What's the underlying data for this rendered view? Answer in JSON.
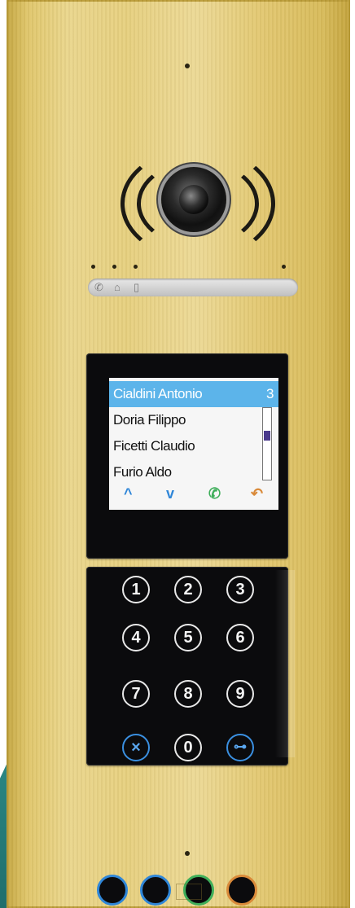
{
  "lcd": {
    "entries": [
      {
        "name": "Cialdini Antonio",
        "count": "3"
      },
      {
        "name": "Doria Filippo"
      },
      {
        "name": "Ficetti Claudio"
      },
      {
        "name": "Furio Aldo"
      }
    ],
    "nav": {
      "up": "^",
      "down": "v",
      "call": "✆",
      "back": "↶"
    },
    "accent": "#5cb4ea"
  },
  "indicators": {
    "icons": [
      "handset-icon",
      "door-icon",
      "speaker-icon"
    ]
  },
  "keypad": {
    "keys": [
      "1",
      "2",
      "3",
      "4",
      "5",
      "6",
      "7",
      "8",
      "9",
      "×",
      "0",
      "⊶"
    ],
    "key_icons": {
      "cancel": "cancel-icon",
      "key": "key-icon"
    }
  },
  "colors": {
    "panel": "#e6cf7e",
    "ring_blue": "#2f86d8",
    "ring_green": "#3fae5a",
    "ring_orange": "#d98a3a"
  }
}
